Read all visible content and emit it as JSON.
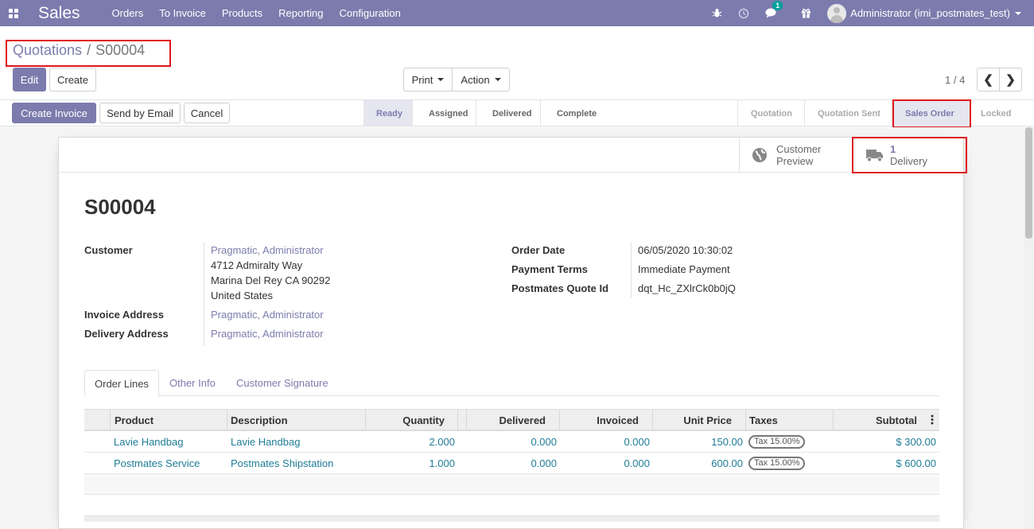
{
  "navbar": {
    "app_name": "Sales",
    "menu": [
      "Orders",
      "To Invoice",
      "Products",
      "Reporting",
      "Configuration"
    ],
    "messages_count": "1",
    "user_name": "Administrator (imi_postmates_test)"
  },
  "breadcrumb": {
    "parent": "Quotations",
    "separator": "/",
    "current": "S00004"
  },
  "control": {
    "edit_label": "Edit",
    "create_label": "Create",
    "print_label": "Print",
    "action_label": "Action",
    "pager_value": "1 / 4"
  },
  "statusbar": {
    "create_invoice": "Create Invoice",
    "send_email": "Send by Email",
    "cancel": "Cancel",
    "delivery_stages": [
      "Ready",
      "Assigned",
      "Delivered",
      "Complete"
    ],
    "order_states": [
      "Quotation",
      "Quotation Sent",
      "Sales Order",
      "Locked"
    ]
  },
  "smart_buttons": {
    "preview_line1": "Customer",
    "preview_line2": "Preview",
    "delivery_count": "1",
    "delivery_label": "Delivery"
  },
  "form": {
    "title": "S00004",
    "customer_label": "Customer",
    "customer_name": "Pragmatic, Administrator",
    "customer_addr1": "4712 Admiralty Way",
    "customer_addr2": "Marina Del Rey CA 90292",
    "customer_addr3": "United States",
    "invoice_label": "Invoice Address",
    "invoice_value": "Pragmatic, Administrator",
    "delivery_label": "Delivery Address",
    "delivery_value": "Pragmatic, Administrator",
    "order_date_label": "Order Date",
    "order_date_value": "06/05/2020 10:30:02",
    "payment_terms_label": "Payment Terms",
    "payment_terms_value": "Immediate Payment",
    "quote_id_label": "Postmates Quote Id",
    "quote_id_value": "dqt_Hc_ZXlrCk0b0jQ"
  },
  "tabs": [
    "Order Lines",
    "Other Info",
    "Customer Signature"
  ],
  "order_lines": {
    "headers": [
      "Product",
      "Description",
      "Quantity",
      "Delivered",
      "Invoiced",
      "Unit Price",
      "Taxes",
      "Subtotal"
    ],
    "rows": [
      {
        "product": "Lavie Handbag",
        "description": "Lavie Handbag",
        "quantity": "2.000",
        "delivered": "0.000",
        "invoiced": "0.000",
        "unit_price": "150.00",
        "taxes": "Tax 15.00%",
        "subtotal": "$ 300.00"
      },
      {
        "product": "Postmates Service",
        "description": "Postmates Shipstation",
        "quantity": "1.000",
        "delivered": "0.000",
        "invoiced": "0.000",
        "unit_price": "600.00",
        "taxes": "Tax 15.00%",
        "subtotal": "$ 600.00"
      }
    ]
  },
  "colors": {
    "brand": "#7c7bad",
    "link": "#1f7c96",
    "highlight": "#e0171e"
  }
}
